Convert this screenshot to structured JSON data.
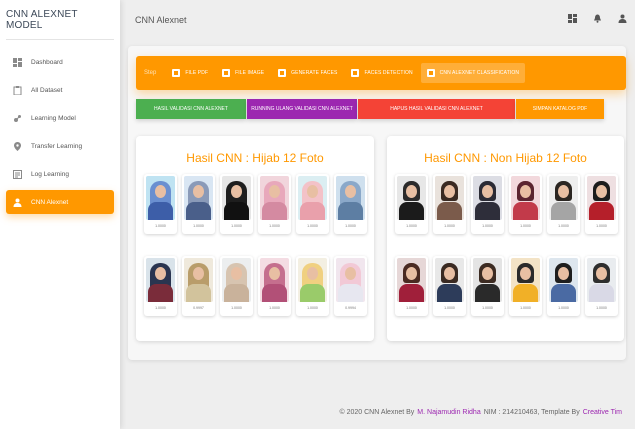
{
  "sidebar": {
    "brand": "CNN ALEXNET MODEL",
    "items": [
      {
        "label": "Dashboard",
        "icon": "dashboard-icon",
        "active": false
      },
      {
        "label": "All Dataset",
        "icon": "clipboard-icon",
        "active": false
      },
      {
        "label": "Learning Model",
        "icon": "brain-icon",
        "active": false
      },
      {
        "label": "Transfer Learning",
        "icon": "location-pin-icon",
        "active": false
      },
      {
        "label": "Log Learning",
        "icon": "list-icon",
        "active": false
      },
      {
        "label": "CNN Alexnet",
        "icon": "person-icon",
        "active": true
      }
    ]
  },
  "header": {
    "title": "CNN Alexnet",
    "tools": [
      "dashboard-icon",
      "bell-icon",
      "person-icon"
    ]
  },
  "tabs": {
    "step_label": "Step",
    "items": [
      {
        "label": "FILE PDF",
        "active": false
      },
      {
        "label": "FILE IMAGE",
        "active": false
      },
      {
        "label": "GENERATE FACES",
        "active": false
      },
      {
        "label": "FACES DETECTION",
        "active": false
      },
      {
        "label": "CNN ALEXNET CLASSIFICATION",
        "active": true
      }
    ]
  },
  "actions": {
    "validate": "HASIL VALIDASI CNN ALEXNET",
    "rerun": "RUNNING ULANG VALIDASI CNN ALEXNET",
    "delete": "HAPUS HASIL VALIDASI CNN ALEXNET",
    "save": "SIMPAN KATALOG PDF"
  },
  "results": {
    "hijab": {
      "title": "Hasil CNN : Hijab 12 Foto",
      "scores": [
        "1.0000",
        "1.0000",
        "1.0000",
        "1.0000",
        "1.0000",
        "1.0000",
        "1.0000",
        "0.9997",
        "1.0000",
        "1.0000",
        "1.0000",
        "0.9994"
      ]
    },
    "nonhijab": {
      "title": "Hasil CNN : Non Hijab 12 Foto",
      "scores": [
        "1.0000",
        "1.0000",
        "1.0000",
        "1.0000",
        "1.0000",
        "1.0000",
        "1.0000",
        "1.0000",
        "1.0000",
        "1.0000",
        "1.0000",
        "1.0000"
      ]
    }
  },
  "footer": {
    "prefix": "© 2020 CNN Alexnet By",
    "author": "M. Najamudin Ridha",
    "nim": "NIM : 214210463, Template By",
    "template": "Creative Tim"
  },
  "colors": {
    "accent": "#ff9800",
    "success": "#4caf50",
    "purple": "#9c27b0",
    "danger": "#f44336"
  }
}
